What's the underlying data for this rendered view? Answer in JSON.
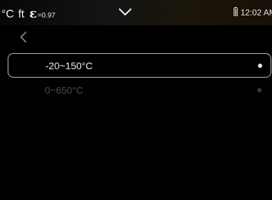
{
  "status_bar": {
    "temperature_unit": "°C",
    "distance_unit": "ft",
    "emissivity_symbol": "ε",
    "emissivity_value": "=0.97",
    "dropdown_icon": "chevron-down-icon",
    "battery_icon": "battery-icon",
    "time": "12:02 AM"
  },
  "nav": {
    "back_icon": "chevron-left-icon"
  },
  "range_options": [
    {
      "label": "-20~150°C",
      "selected": true
    },
    {
      "label": "0~650°C",
      "selected": false
    }
  ],
  "colors": {
    "background": "#000000",
    "text_primary": "#f0f0f0",
    "text_disabled": "#4a4a4a",
    "selection_border": "#bdbdbd"
  }
}
